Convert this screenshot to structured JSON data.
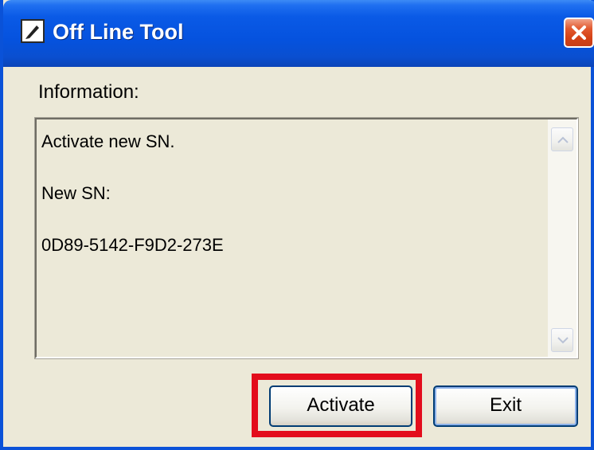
{
  "window": {
    "title": "Off Line Tool",
    "app_icon": "pen-tool-icon",
    "close_icon": "close-icon"
  },
  "info": {
    "label": "Information:",
    "lines": [
      "Activate new SN.",
      "New SN:",
      "0D89-5142-F9D2-273E"
    ]
  },
  "scrollbar": {
    "up_icon": "scroll-up-arrow-icon",
    "down_icon": "scroll-down-arrow-icon"
  },
  "buttons": {
    "activate_label": "Activate",
    "exit_label": "Exit"
  },
  "colors": {
    "titlebar": "#0552de",
    "dialog_bg": "#ece9d8",
    "highlight": "#e30d1c",
    "close_button": "#d44115"
  }
}
